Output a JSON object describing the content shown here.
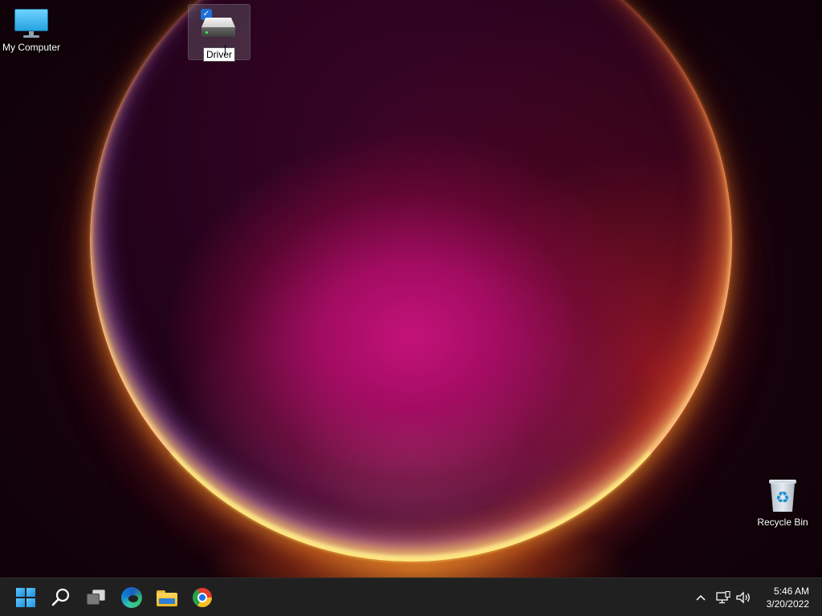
{
  "desktop": {
    "icons": [
      {
        "label": "My Computer",
        "icon": "monitor-icon"
      },
      {
        "label": "Driver",
        "icon": "drive-icon",
        "selected": true,
        "renaming": true
      },
      {
        "label": "Recycle Bin",
        "icon": "recycle-bin-icon"
      }
    ],
    "check_glyph": "✓"
  },
  "taskbar": {
    "pinned": [
      {
        "name": "start",
        "icon": "windows-logo-icon"
      },
      {
        "name": "search",
        "icon": "search-icon"
      },
      {
        "name": "task-view",
        "icon": "task-view-icon"
      },
      {
        "name": "edge",
        "icon": "edge-icon"
      },
      {
        "name": "file-explorer",
        "icon": "folder-icon"
      },
      {
        "name": "chrome",
        "icon": "chrome-icon"
      }
    ],
    "tray": {
      "chevron_glyph": "^",
      "time": "5:46 AM",
      "date": "3/20/2022"
    },
    "background": "#202020"
  },
  "colors": {
    "accent": "#1e6fd6",
    "wallpaper_core": "#c4127a"
  }
}
